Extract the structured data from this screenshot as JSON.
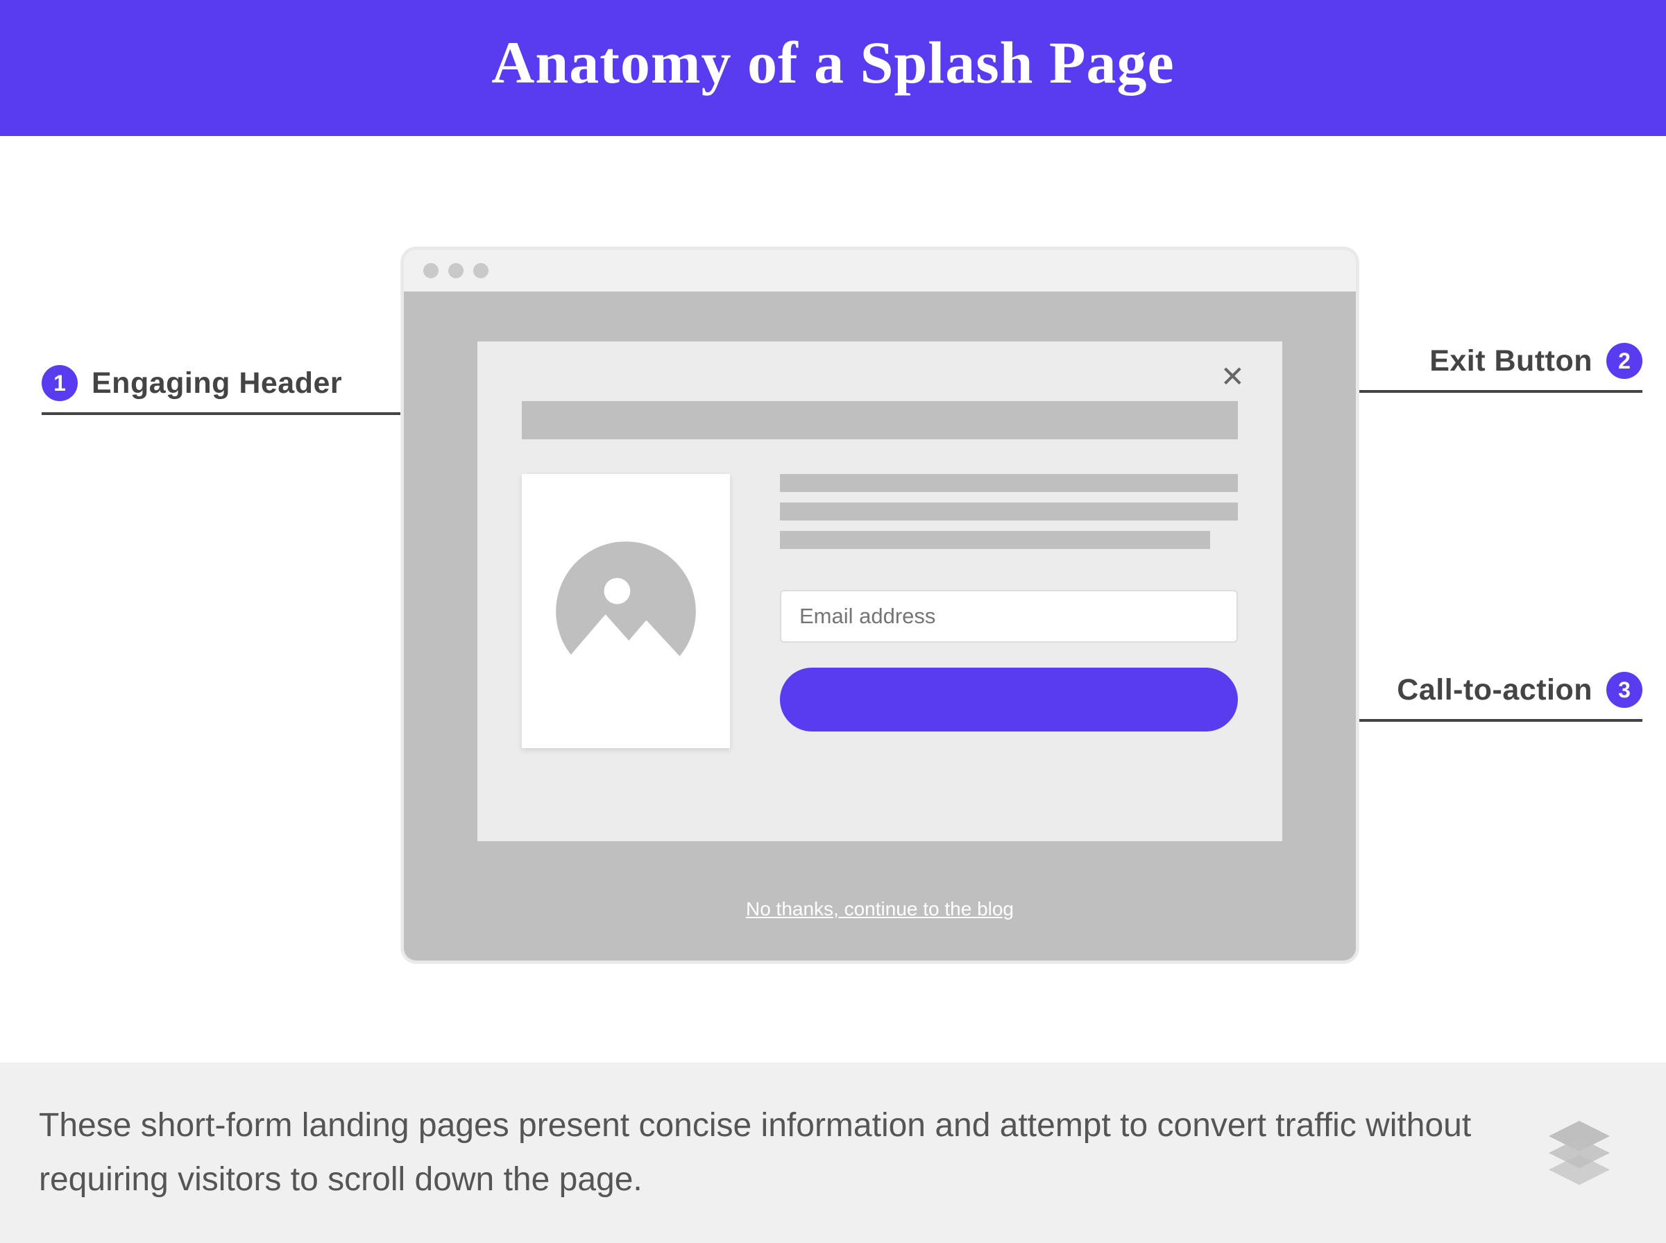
{
  "title": "Anatomy of a Splash Page",
  "callouts": {
    "c1": {
      "number": "1",
      "label": "Engaging Header"
    },
    "c2": {
      "number": "2",
      "label": "Exit Button"
    },
    "c3": {
      "number": "3",
      "label": "Call-to-action"
    }
  },
  "splash": {
    "email_placeholder": "Email address",
    "skip_link": "No thanks, continue to the blog"
  },
  "footer": {
    "text": "These short-form landing pages present concise information and attempt to convert traffic without requiring visitors to scroll down the page."
  },
  "colors": {
    "accent": "#5a3cf0",
    "grey_body": "#bfbfbf",
    "grey_light": "#ececec"
  }
}
